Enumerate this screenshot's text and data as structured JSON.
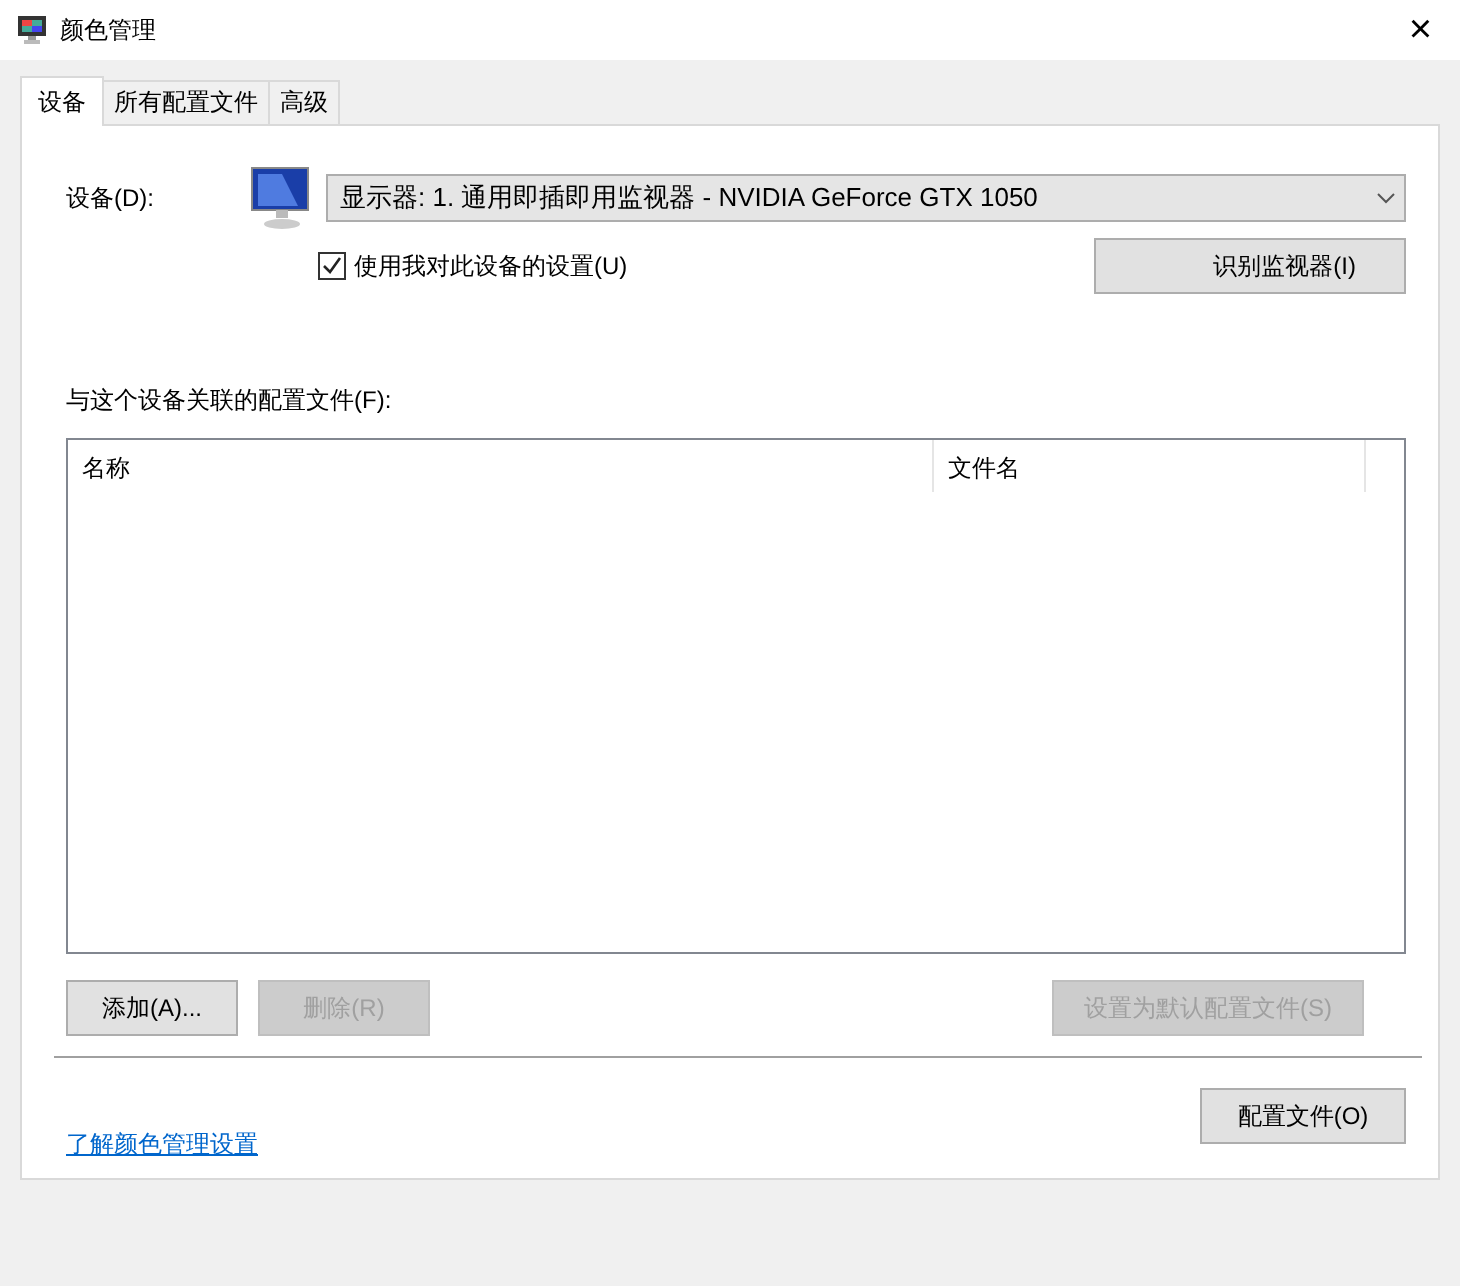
{
  "window": {
    "title": "颜色管理",
    "close": "×"
  },
  "tabs": [
    {
      "label": "设备",
      "selected": true
    },
    {
      "label": "所有配置文件",
      "selected": false
    },
    {
      "label": "高级",
      "selected": false
    }
  ],
  "device": {
    "label": "设备(D):",
    "value": "显示器: 1. 通用即插即用监视器 - NVIDIA GeForce GTX 1050",
    "use_my_settings": {
      "label": "使用我对此设备的设置(U)",
      "checked": true
    },
    "identify_button": "识别监视器(I)"
  },
  "profiles": {
    "label": "与这个设备关联的配置文件(F):",
    "columns": [
      "名称",
      "文件名"
    ]
  },
  "buttons": [
    {
      "label": "添加(A)...",
      "disabled": false
    },
    {
      "label": "删除(R)",
      "disabled": true
    },
    {
      "label": "设置为默认配置文件(S)",
      "disabled": true
    }
  ],
  "link": "了解颜色管理设置",
  "profiles_button": "配置文件(O)"
}
